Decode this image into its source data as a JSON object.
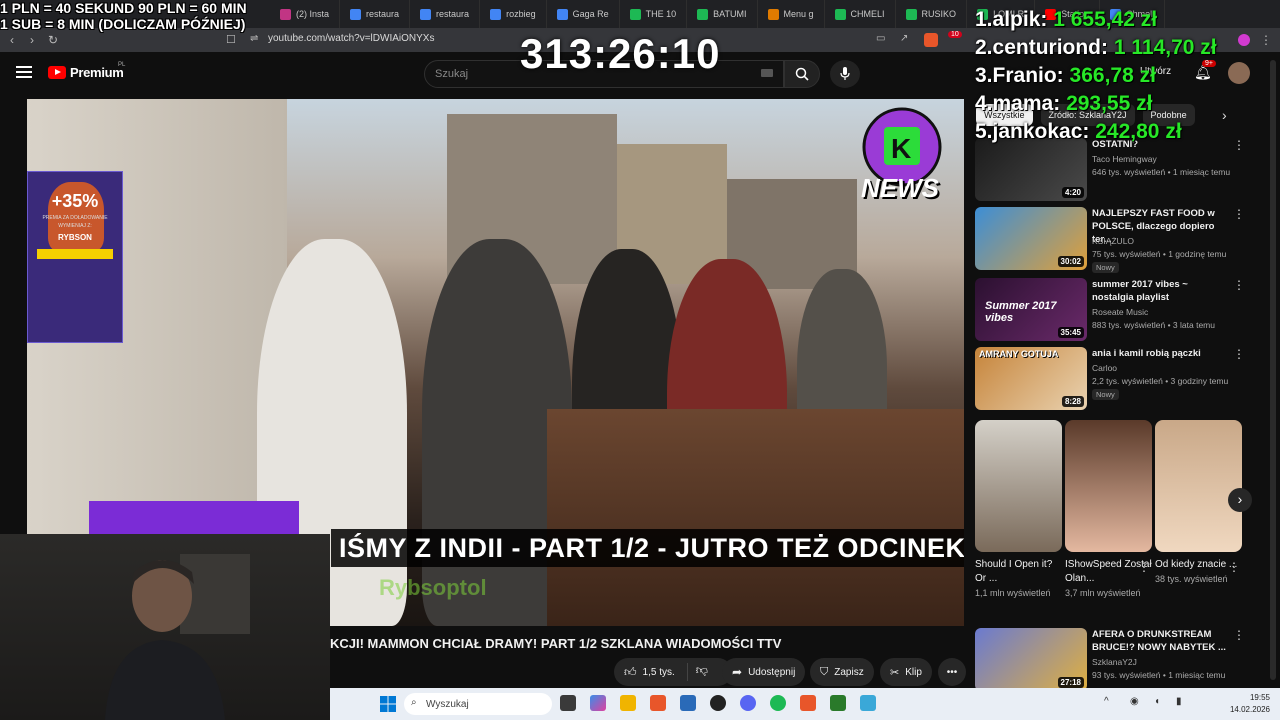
{
  "browser": {
    "tabs": [
      {
        "label": "(2) Insta",
        "color": "#c13584"
      },
      {
        "label": "restaura",
        "color": "#4285f4"
      },
      {
        "label": "restaura",
        "color": "#4285f4"
      },
      {
        "label": "rozbieg",
        "color": "#4285f4"
      },
      {
        "label": "Gaga Re",
        "color": "#4285f4"
      },
      {
        "label": "THE 10",
        "color": "#1db954"
      },
      {
        "label": "BATUMI",
        "color": "#1db954"
      },
      {
        "label": "Menu g",
        "color": "#e07b00"
      },
      {
        "label": "CHMELI",
        "color": "#1db954"
      },
      {
        "label": "RUSIKO",
        "color": "#1db954"
      },
      {
        "label": "LOMI R",
        "color": "#1db954"
      },
      {
        "label": "Station",
        "color": "#ff0000"
      },
      {
        "label": "Chmeli",
        "color": "#4285f4"
      }
    ],
    "url": "youtube.com/watch?v=lDWIAiONYXs",
    "extension_badge": "10"
  },
  "overlay": {
    "info_line1": "1 PLN =  40 SEKUND 90 PLN = 60 MIN",
    "info_line2": "1 SUB = 8 MIN (DOLICZAM PÓŹNIEJ)",
    "timer": "313:26:10",
    "leaderboard": [
      {
        "rank_name": "1.alpik:",
        "amount": "1 655,42 zł"
      },
      {
        "rank_name": "2.centuriond:",
        "amount": "1 114,70 zł"
      },
      {
        "rank_name": "3.Franio:",
        "amount": "366,78 zł"
      },
      {
        "rank_name": "4.mama:",
        "amount": "293,55 zł"
      },
      {
        "rank_name": "5.jankokac:",
        "amount": "242,80 zł"
      }
    ]
  },
  "youtube": {
    "logo_text": "Premium",
    "logo_region": "PL",
    "search_placeholder": "Szukaj",
    "create_label": "Utwórz",
    "notifications_count": "9+",
    "video_title": "KCJI! MAMMON CHCIAŁ DRAMY! PART 1/2 SZKLANA WIADOMOŚCI TTV",
    "actions": {
      "likes": "1,5 tys.",
      "share": "Udostępnij",
      "save": "Zapisz",
      "clip": "Klip"
    },
    "chips": [
      "Wszystkie",
      "Źródło: SzklanaY2J",
      "Podobne"
    ],
    "recommendations": [
      {
        "title": "OSTATNI?",
        "channel": "Taco Hemingway",
        "verified": true,
        "meta": "646 tys. wyświetleń • 1 miesiąc temu",
        "duration": "4:20",
        "badge": ""
      },
      {
        "title": "NAJLEPSZY FAST FOOD w POLSCE, dlaczego dopiero ter...",
        "channel": "KSIĄŻULO",
        "verified": true,
        "meta": "75 tys. wyświetleń • 1 godzinę temu",
        "duration": "30:02",
        "badge": "Nowy"
      },
      {
        "title": "summer 2017 vibes ~ nostalgia playlist",
        "channel": "Roseate Music",
        "verified": true,
        "meta": "883 tys. wyświetleń • 3 lata temu",
        "duration": "35:45",
        "badge": ""
      },
      {
        "title": "ania i kamil robią pączki",
        "channel": "Carloo",
        "verified": false,
        "meta": "2,2 tys. wyświetleń • 3 godziny temu",
        "duration": "8:28",
        "badge": "Nowy"
      },
      {
        "title": "AFERA O DRUNKSTREAM BRUCE!? NOWY NABYTEK ...",
        "channel": "SzklanaY2J",
        "verified": false,
        "meta": "93 tys. wyświetleń • 1 miesiąc temu",
        "duration": "27:18",
        "badge": ""
      }
    ],
    "shorts": [
      {
        "title": "Should I Open it? Or ...",
        "views": "1,1 mln wyświetleń"
      },
      {
        "title": "IShowSpeed Został Olan...",
        "views": "3,7 mln wyświetleń"
      },
      {
        "title": "Od kiedy znacie ...",
        "views": "38 tys. wyświetleń"
      }
    ]
  },
  "video_overlay": {
    "subtitle": "IŚMY Z INDII - PART 1/2 - JUTRO TEŻ ODCINEK!",
    "news_logo": "NEWS",
    "news_letter": "K",
    "promo_percent": "+35%",
    "promo_sub": "PREMIA ZA DOŁADOWANIE",
    "promo_label": "WYMIENIAJ Z:",
    "promo_name": "RYBSON",
    "green_tag": "Rybsoptol"
  },
  "taskbar": {
    "search_placeholder": "Wyszukaj",
    "time": "19:55",
    "date": "14.02.2026"
  }
}
